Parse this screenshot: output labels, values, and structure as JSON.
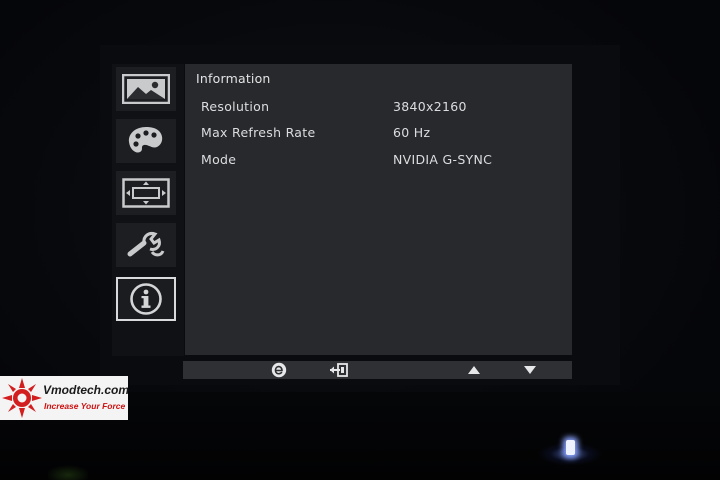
{
  "osd": {
    "title": "Information",
    "rows": [
      {
        "label": "Resolution",
        "value": "3840x2160"
      },
      {
        "label": "Max Refresh Rate",
        "value": "60 Hz"
      },
      {
        "label": "Mode",
        "value": "NVIDIA G-SYNC"
      }
    ],
    "sidebar": [
      {
        "icon": "picture-icon",
        "selected": false
      },
      {
        "icon": "color-palette-icon",
        "selected": false
      },
      {
        "icon": "display-position-icon",
        "selected": false
      },
      {
        "icon": "wrench-settings-icon",
        "selected": false
      },
      {
        "icon": "information-icon",
        "selected": true
      }
    ],
    "keybar": [
      {
        "icon": "e-mode-icon"
      },
      {
        "icon": "exit-icon"
      },
      {
        "icon": "arrow-up-icon"
      },
      {
        "icon": "arrow-down-icon"
      }
    ],
    "colors": {
      "content_bg": "#27292c",
      "sidebar_bg": "#0f1114",
      "text": "#dcdddf",
      "selected_border": "#d9dadb"
    }
  },
  "watermark": {
    "site": "Vmodtech.com",
    "tagline": "Increase Your Force"
  }
}
